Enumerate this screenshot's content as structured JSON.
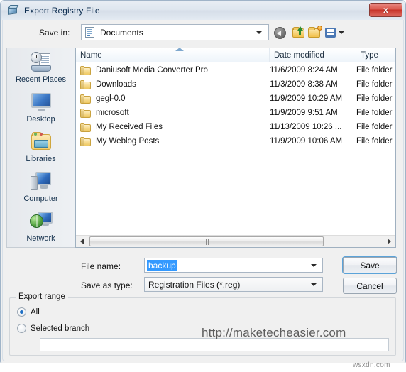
{
  "window": {
    "title": "Export Registry File",
    "title_icon": "registry-editor-icon",
    "close_label": "x"
  },
  "toolbar": {
    "savein_label": "Save in:",
    "savein_value": "Documents",
    "savein_icon": "documents-icon",
    "buttons": [
      {
        "name": "back-button",
        "icon": "back-arrow-icon"
      },
      {
        "name": "up-one-level-button",
        "icon": "up-folder-icon"
      },
      {
        "name": "new-folder-button",
        "icon": "new-folder-icon"
      },
      {
        "name": "views-button",
        "icon": "views-grid-icon"
      }
    ]
  },
  "places": {
    "items": [
      {
        "label": "Recent Places",
        "icon": "recent-places-icon"
      },
      {
        "label": "Desktop",
        "icon": "desktop-icon"
      },
      {
        "label": "Libraries",
        "icon": "libraries-icon"
      },
      {
        "label": "Computer",
        "icon": "computer-icon"
      },
      {
        "label": "Network",
        "icon": "network-icon"
      }
    ]
  },
  "file_list": {
    "columns": [
      "Name",
      "Date modified",
      "Type"
    ],
    "rows": [
      {
        "name": "Daniusoft Media Converter Pro",
        "date": "11/6/2009 8:24 AM",
        "type": "File folder"
      },
      {
        "name": "Downloads",
        "date": "11/3/2009 8:38 AM",
        "type": "File folder"
      },
      {
        "name": "gegl-0.0",
        "date": "11/9/2009 10:29 AM",
        "type": "File folder"
      },
      {
        "name": "microsoft",
        "date": "11/9/2009 9:51 AM",
        "type": "File folder"
      },
      {
        "name": "My Received Files",
        "date": "11/13/2009 10:26 ...",
        "type": "File folder"
      },
      {
        "name": "My Weblog Posts",
        "date": "11/9/2009 10:06 AM",
        "type": "File folder"
      }
    ]
  },
  "form": {
    "filename_label": "File name:",
    "filename_value": "backup",
    "savetype_label": "Save as type:",
    "savetype_value": "Registration Files (*.reg)",
    "save_button": "Save",
    "cancel_button": "Cancel"
  },
  "export_range": {
    "legend": "Export range",
    "options": [
      {
        "label": "All",
        "selected": true
      },
      {
        "label": "Selected branch",
        "selected": false
      }
    ],
    "branch_value": ""
  },
  "watermarks": {
    "main": "http://maketecheasier.com",
    "corner": "wsxdn.com"
  },
  "colors": {
    "accent": "#3399ff",
    "close_red": "#c7342a",
    "focus_ring": "#5ba3d9"
  }
}
